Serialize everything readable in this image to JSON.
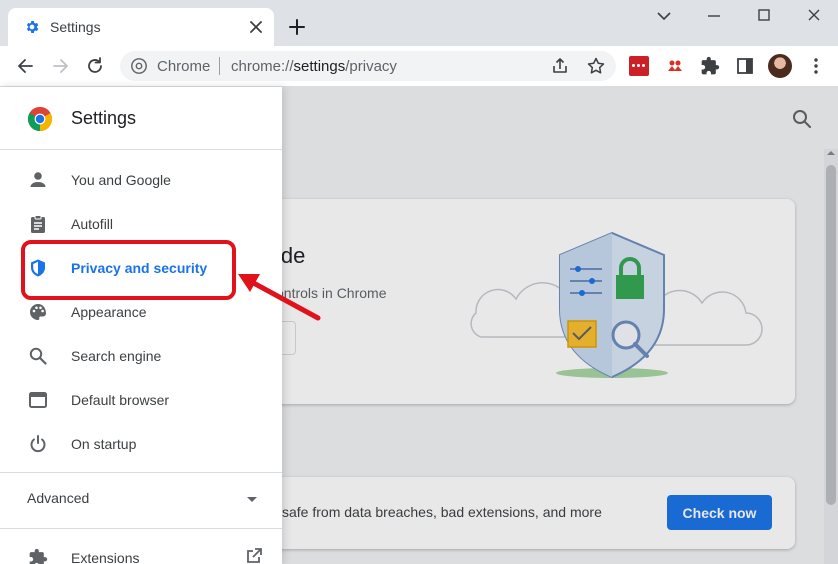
{
  "tab": {
    "title": "Settings"
  },
  "omnibox": {
    "scheme": "Chrome",
    "url_prefix": "chrome://",
    "url_host": "settings",
    "url_path": "/privacy"
  },
  "drawer": {
    "title": "Settings",
    "items": [
      {
        "label": "You and Google",
        "icon": "person-icon"
      },
      {
        "label": "Autofill",
        "icon": "clipboard-icon"
      },
      {
        "label": "Privacy and security",
        "icon": "shield-icon",
        "active": true
      },
      {
        "label": "Appearance",
        "icon": "palette-icon"
      },
      {
        "label": "Search engine",
        "icon": "search-icon"
      },
      {
        "label": "Default browser",
        "icon": "browser-icon"
      },
      {
        "label": "On startup",
        "icon": "power-icon"
      }
    ],
    "advanced_label": "Advanced",
    "extensions_label": "Extensions"
  },
  "content": {
    "card1_title": "ide",
    "card1_subtitle": "ontrols in Chrome",
    "card2_text": "safe from data breaches, bad extensions, and more",
    "check_now_label": "Check now"
  },
  "colors": {
    "accent": "#1a73e8",
    "annotation": "#e0131c",
    "tabstrip": "#dee1e6"
  }
}
